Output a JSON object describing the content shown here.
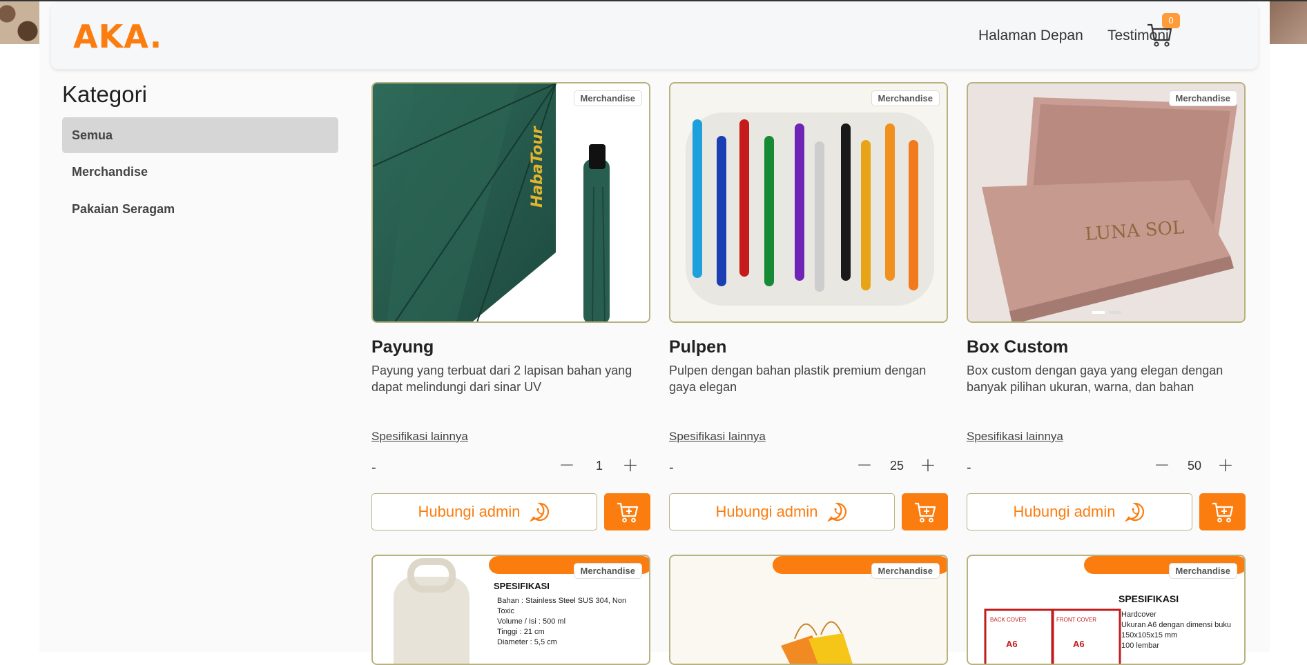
{
  "header": {
    "logo": "AKA.",
    "nav": [
      {
        "label": "Halaman Depan"
      },
      {
        "label": "Testimoni"
      }
    ],
    "cart_count": "0"
  },
  "sidebar": {
    "title": "Kategori",
    "items": [
      {
        "label": "Semua",
        "active": true
      },
      {
        "label": "Merchandise",
        "active": false
      },
      {
        "label": "Pakaian Seragam",
        "active": false
      }
    ]
  },
  "products": [
    {
      "badge": "Merchandise",
      "title": "Payung",
      "description": "Payung yang terbuat dari 2 lapisan bahan yang dapat melindungi dari sinar UV",
      "spec_link": "Spesifikasi lainnya",
      "dash": "-",
      "quantity": "1",
      "contact_label": "Hubungi admin",
      "image_text": "HabaTour"
    },
    {
      "badge": "Merchandise",
      "title": "Pulpen",
      "description": "Pulpen dengan bahan plastik premium dengan gaya elegan",
      "spec_link": "Spesifikasi lainnya",
      "dash": "-",
      "quantity": "25",
      "contact_label": "Hubungi admin"
    },
    {
      "badge": "Merchandise",
      "title": "Box Custom",
      "description": "Box custom dengan gaya yang elegan dengan banyak pilihan ukuran, warna, dan bahan",
      "spec_link": "Spesifikasi lainnya",
      "dash": "-",
      "quantity": "50",
      "contact_label": "Hubungi admin",
      "image_text": "LUNA SOL"
    }
  ],
  "products_row2": [
    {
      "badge": "Merchandise",
      "spec_heading": "SPESIFIKASI",
      "spec_items": [
        "Bahan : Stainless Steel SUS 304, Non Toxic",
        "Volume / Isi : 500 ml",
        "Tinggi : 21 cm",
        "Diameter : 5,5 cm"
      ]
    },
    {
      "badge": "Merchandise"
    },
    {
      "badge": "Merchandise",
      "spec_heading": "SPESIFIKASI",
      "spec_items": [
        "Hardcover",
        "Ukuran A6 dengan dimensi buku 150x105x15 mm",
        "100 lembar"
      ],
      "cover_labels": [
        "BACK COVER",
        "FRONT COVER"
      ],
      "cover_size": "A6"
    }
  ],
  "colors": {
    "accent": "#fb7d10",
    "card_border": "#b7b27f",
    "active_category": "#d6d6d6",
    "cart_badge": "#ff9c3a"
  }
}
